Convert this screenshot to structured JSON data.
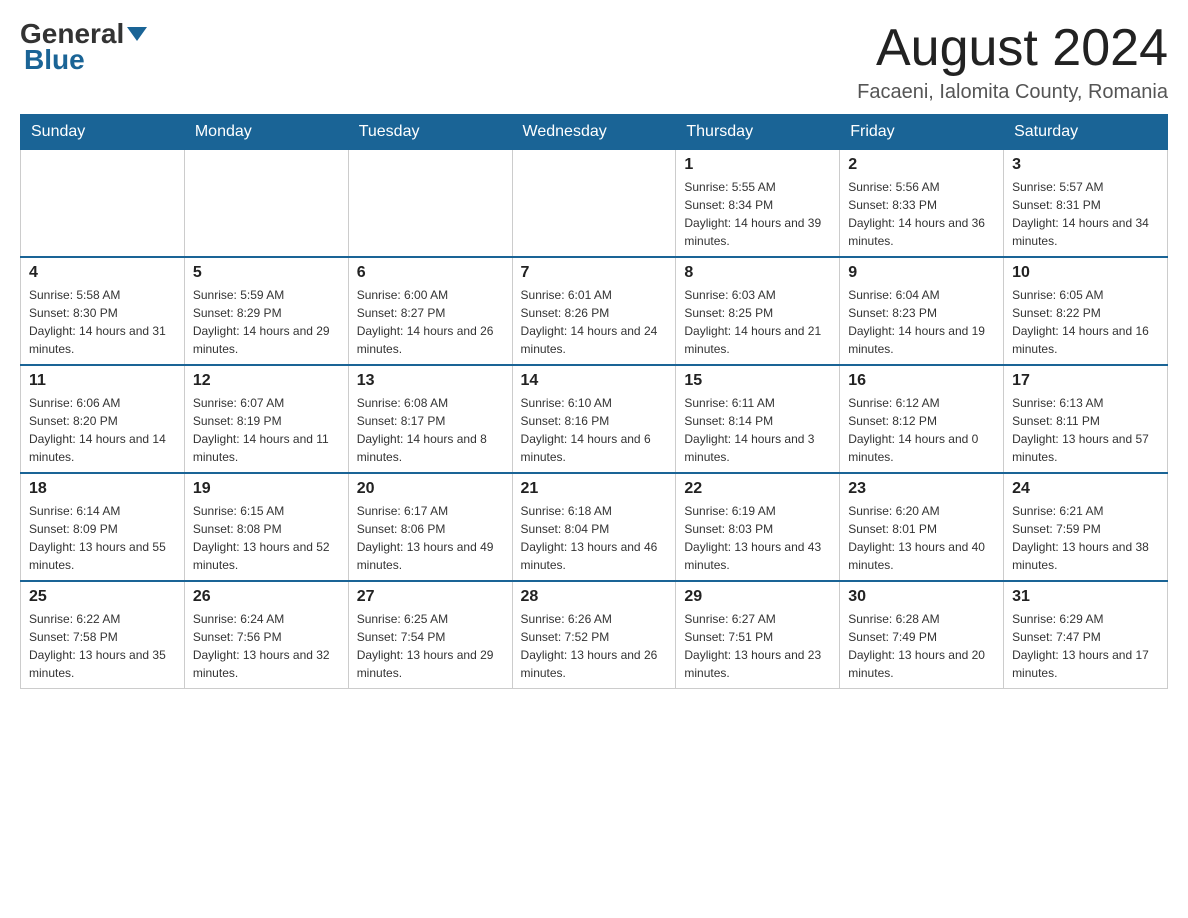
{
  "header": {
    "logo_general": "General",
    "logo_blue": "Blue",
    "month_title": "August 2024",
    "location": "Facaeni, Ialomita County, Romania"
  },
  "days_of_week": [
    "Sunday",
    "Monday",
    "Tuesday",
    "Wednesday",
    "Thursday",
    "Friday",
    "Saturday"
  ],
  "weeks": [
    [
      {
        "day": "",
        "info": ""
      },
      {
        "day": "",
        "info": ""
      },
      {
        "day": "",
        "info": ""
      },
      {
        "day": "",
        "info": ""
      },
      {
        "day": "1",
        "info": "Sunrise: 5:55 AM\nSunset: 8:34 PM\nDaylight: 14 hours and 39 minutes."
      },
      {
        "day": "2",
        "info": "Sunrise: 5:56 AM\nSunset: 8:33 PM\nDaylight: 14 hours and 36 minutes."
      },
      {
        "day": "3",
        "info": "Sunrise: 5:57 AM\nSunset: 8:31 PM\nDaylight: 14 hours and 34 minutes."
      }
    ],
    [
      {
        "day": "4",
        "info": "Sunrise: 5:58 AM\nSunset: 8:30 PM\nDaylight: 14 hours and 31 minutes."
      },
      {
        "day": "5",
        "info": "Sunrise: 5:59 AM\nSunset: 8:29 PM\nDaylight: 14 hours and 29 minutes."
      },
      {
        "day": "6",
        "info": "Sunrise: 6:00 AM\nSunset: 8:27 PM\nDaylight: 14 hours and 26 minutes."
      },
      {
        "day": "7",
        "info": "Sunrise: 6:01 AM\nSunset: 8:26 PM\nDaylight: 14 hours and 24 minutes."
      },
      {
        "day": "8",
        "info": "Sunrise: 6:03 AM\nSunset: 8:25 PM\nDaylight: 14 hours and 21 minutes."
      },
      {
        "day": "9",
        "info": "Sunrise: 6:04 AM\nSunset: 8:23 PM\nDaylight: 14 hours and 19 minutes."
      },
      {
        "day": "10",
        "info": "Sunrise: 6:05 AM\nSunset: 8:22 PM\nDaylight: 14 hours and 16 minutes."
      }
    ],
    [
      {
        "day": "11",
        "info": "Sunrise: 6:06 AM\nSunset: 8:20 PM\nDaylight: 14 hours and 14 minutes."
      },
      {
        "day": "12",
        "info": "Sunrise: 6:07 AM\nSunset: 8:19 PM\nDaylight: 14 hours and 11 minutes."
      },
      {
        "day": "13",
        "info": "Sunrise: 6:08 AM\nSunset: 8:17 PM\nDaylight: 14 hours and 8 minutes."
      },
      {
        "day": "14",
        "info": "Sunrise: 6:10 AM\nSunset: 8:16 PM\nDaylight: 14 hours and 6 minutes."
      },
      {
        "day": "15",
        "info": "Sunrise: 6:11 AM\nSunset: 8:14 PM\nDaylight: 14 hours and 3 minutes."
      },
      {
        "day": "16",
        "info": "Sunrise: 6:12 AM\nSunset: 8:12 PM\nDaylight: 14 hours and 0 minutes."
      },
      {
        "day": "17",
        "info": "Sunrise: 6:13 AM\nSunset: 8:11 PM\nDaylight: 13 hours and 57 minutes."
      }
    ],
    [
      {
        "day": "18",
        "info": "Sunrise: 6:14 AM\nSunset: 8:09 PM\nDaylight: 13 hours and 55 minutes."
      },
      {
        "day": "19",
        "info": "Sunrise: 6:15 AM\nSunset: 8:08 PM\nDaylight: 13 hours and 52 minutes."
      },
      {
        "day": "20",
        "info": "Sunrise: 6:17 AM\nSunset: 8:06 PM\nDaylight: 13 hours and 49 minutes."
      },
      {
        "day": "21",
        "info": "Sunrise: 6:18 AM\nSunset: 8:04 PM\nDaylight: 13 hours and 46 minutes."
      },
      {
        "day": "22",
        "info": "Sunrise: 6:19 AM\nSunset: 8:03 PM\nDaylight: 13 hours and 43 minutes."
      },
      {
        "day": "23",
        "info": "Sunrise: 6:20 AM\nSunset: 8:01 PM\nDaylight: 13 hours and 40 minutes."
      },
      {
        "day": "24",
        "info": "Sunrise: 6:21 AM\nSunset: 7:59 PM\nDaylight: 13 hours and 38 minutes."
      }
    ],
    [
      {
        "day": "25",
        "info": "Sunrise: 6:22 AM\nSunset: 7:58 PM\nDaylight: 13 hours and 35 minutes."
      },
      {
        "day": "26",
        "info": "Sunrise: 6:24 AM\nSunset: 7:56 PM\nDaylight: 13 hours and 32 minutes."
      },
      {
        "day": "27",
        "info": "Sunrise: 6:25 AM\nSunset: 7:54 PM\nDaylight: 13 hours and 29 minutes."
      },
      {
        "day": "28",
        "info": "Sunrise: 6:26 AM\nSunset: 7:52 PM\nDaylight: 13 hours and 26 minutes."
      },
      {
        "day": "29",
        "info": "Sunrise: 6:27 AM\nSunset: 7:51 PM\nDaylight: 13 hours and 23 minutes."
      },
      {
        "day": "30",
        "info": "Sunrise: 6:28 AM\nSunset: 7:49 PM\nDaylight: 13 hours and 20 minutes."
      },
      {
        "day": "31",
        "info": "Sunrise: 6:29 AM\nSunset: 7:47 PM\nDaylight: 13 hours and 17 minutes."
      }
    ]
  ]
}
